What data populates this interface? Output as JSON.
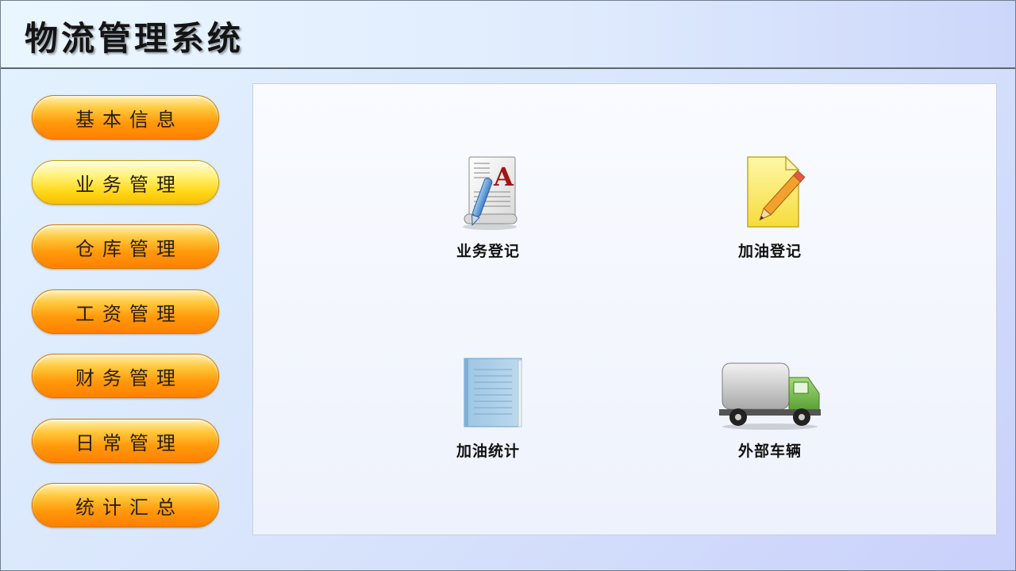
{
  "app": {
    "title": "物流管理系统"
  },
  "sidebar": {
    "items": [
      {
        "label": "基本信息"
      },
      {
        "label": "业务管理",
        "active": true
      },
      {
        "label": "仓库管理"
      },
      {
        "label": "工资管理"
      },
      {
        "label": "财务管理"
      },
      {
        "label": "日常管理"
      },
      {
        "label": "统计汇总"
      }
    ]
  },
  "main": {
    "tiles": [
      {
        "label": "业务登记",
        "icon": "document-edit-icon"
      },
      {
        "label": "加油登记",
        "icon": "note-pencil-icon"
      },
      {
        "label": "加油统计",
        "icon": "notebook-icon"
      },
      {
        "label": "外部车辆",
        "icon": "truck-icon"
      }
    ]
  },
  "colors": {
    "button_orange": "#ff9a0c",
    "button_active_yellow": "#ffe033",
    "background": "#dde8fb"
  }
}
